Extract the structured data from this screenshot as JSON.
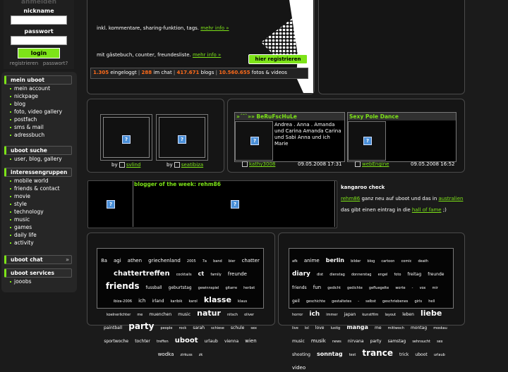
{
  "login": {
    "title": "anmelden",
    "nickname_label": "nickname",
    "password_label": "passwort",
    "button": "login",
    "register_link": "registrieren",
    "forgot_link": "passwort?"
  },
  "sidebar": {
    "sections": [
      {
        "title": "mein uboot",
        "items": [
          "mein account",
          "nickpage",
          "blog",
          "foto, video gallery",
          "postfach",
          "sms & mail",
          "adressbuch"
        ]
      },
      {
        "title": "uboot suche",
        "items": [
          "user, blog, gallery"
        ]
      },
      {
        "title": "interessengruppen",
        "items": [
          "mobile world",
          "friends & contact",
          "movie",
          "style",
          "technology",
          "music",
          "games",
          "daily life",
          "activity"
        ]
      },
      {
        "title": "uboot chat",
        "items": []
      },
      {
        "title": "uboot services",
        "items": [
          "jooobs"
        ]
      }
    ],
    "chat_arrow": "»"
  },
  "promo": {
    "line1": "inkl. kommentare, sharing-funktion, tags.",
    "line1_link": "mehr info »",
    "line2": "mit gästebuch, counter, freundesliste.",
    "line2_link": "mehr info »",
    "register_button": "hier registrieren"
  },
  "stats": {
    "logged_in_count": "1.305",
    "logged_in_label": "eingeloggt",
    "chat_count": "288",
    "chat_label": "im chat",
    "blogs_count": "417.671",
    "blogs_label": "blogs",
    "media_count": "10.560.655",
    "media_label": "fotos & videos",
    "sep": "|"
  },
  "users": {
    "by": "by",
    "user1": "svlind",
    "user2": "seatibiza"
  },
  "blogs": {
    "blog1_title": "»´¯`»» BeRuFscHuLe",
    "blog1_text": "Andrea . Anna . Amanda und Carina Amanda Carina und Sabi Anna und ich Marie",
    "blog1_user": "kathy3008",
    "blog1_date": "09.05.2008 17:31",
    "blog2_title": "Sexy Pole Dance",
    "blog2_user": "webEngine",
    "blog2_date": "09.05.2008 16:52"
  },
  "blogger_week": {
    "title": "blogger of the week: rehm86"
  },
  "kangaroo": {
    "title": "kangaroo check",
    "user": "rehm86",
    "text1": "ganz neu auf uboot und das in",
    "country": "australien",
    "text2": "das gibt einen eintrag in die",
    "hof": "hall of fame",
    "end": ";)"
  },
  "cloud_left": [
    [
      "8a",
      7
    ],
    [
      "agi",
      7
    ],
    [
      "athen",
      7
    ],
    [
      "griechenland",
      7
    ],
    [
      "2005",
      5
    ],
    [
      "7a",
      5
    ],
    [
      "band",
      5
    ],
    [
      "bier",
      5
    ],
    [
      "chatter",
      7
    ],
    [
      "chattertreffen",
      10
    ],
    [
      "cocktails",
      5
    ],
    [
      "ct",
      8
    ],
    [
      "family",
      5
    ],
    [
      "freunde",
      7
    ],
    [
      "friends",
      12
    ],
    [
      "fussball",
      6
    ],
    [
      "geburtstag",
      6
    ],
    [
      "gewinnspiel",
      5
    ],
    [
      "gitarre",
      5
    ],
    [
      "herbst",
      5
    ],
    [
      "ibiza-2006",
      5
    ],
    [
      "ich",
      7
    ],
    [
      "irland",
      6
    ],
    [
      "karibik",
      5
    ],
    [
      "karol",
      5
    ],
    [
      "klasse",
      11
    ],
    [
      "klaus",
      5
    ],
    [
      "koelnerlichter",
      5
    ],
    [
      "me",
      5
    ],
    [
      "muenchen",
      6
    ],
    [
      "music",
      6
    ],
    [
      "natur",
      11
    ],
    [
      "nitsch",
      5
    ],
    [
      "oliver",
      5
    ],
    [
      "paintball",
      6
    ],
    [
      "party",
      12
    ],
    [
      "people",
      5
    ],
    [
      "rock",
      5
    ],
    [
      "sarah",
      6
    ],
    [
      "schiese",
      5
    ],
    [
      "schule",
      6
    ],
    [
      "sex",
      5
    ],
    [
      "sportwoche",
      6
    ],
    [
      "tochter",
      6
    ],
    [
      "treffen",
      5
    ],
    [
      "uboot",
      10
    ],
    [
      "urlaub",
      6
    ],
    [
      "vienna",
      6
    ],
    [
      "wien",
      7
    ],
    [
      "wodka",
      7
    ],
    [
      "zirkuss",
      5
    ],
    [
      "zk",
      5
    ]
  ],
  "cloud_right": [
    [
      "afk",
      5
    ],
    [
      "anime",
      7
    ],
    [
      "berlin",
      8
    ],
    [
      "bilder",
      5
    ],
    [
      "blog",
      5
    ],
    [
      "cartoon",
      5
    ],
    [
      "comic",
      5
    ],
    [
      "death",
      5
    ],
    [
      "diary",
      9
    ],
    [
      "dist",
      5
    ],
    [
      "dienstag",
      5
    ],
    [
      "donnerstag",
      5
    ],
    [
      "engel",
      5
    ],
    [
      "foto",
      5
    ],
    [
      "freitag",
      6
    ],
    [
      "freunde",
      6
    ],
    [
      "friends",
      6
    ],
    [
      "fun",
      7
    ],
    [
      "gedicht",
      5
    ],
    [
      "gedichte",
      5
    ],
    [
      "gefluegelte",
      5
    ],
    [
      "worte",
      5
    ],
    [
      "-",
      5
    ],
    [
      "vox",
      5
    ],
    [
      "mir",
      5
    ],
    [
      "geil",
      6
    ],
    [
      "geschichte",
      5
    ],
    [
      "gestaltetes",
      5
    ],
    [
      "-",
      5
    ],
    [
      "selbst",
      5
    ],
    [
      "geschriebenes",
      5
    ],
    [
      "girls",
      5
    ],
    [
      "hell",
      5
    ],
    [
      "horror",
      5
    ],
    [
      "ich",
      9
    ],
    [
      "immer",
      5
    ],
    [
      "japan",
      6
    ],
    [
      "kunstfilm",
      5
    ],
    [
      "layout",
      5
    ],
    [
      "leben",
      6
    ],
    [
      "liebe",
      11
    ],
    [
      "live",
      5
    ],
    [
      "lol",
      5
    ],
    [
      "love",
      6
    ],
    [
      "lustig",
      5
    ],
    [
      "manga",
      8
    ],
    [
      "me",
      6
    ],
    [
      "mittwoch",
      5
    ],
    [
      "montag",
      6
    ],
    [
      "moskau",
      5
    ],
    [
      "music",
      6
    ],
    [
      "musik",
      7
    ],
    [
      "news",
      5
    ],
    [
      "nirvana",
      6
    ],
    [
      "party",
      6
    ],
    [
      "samstag",
      6
    ],
    [
      "sehnsucht",
      5
    ],
    [
      "sex",
      5
    ],
    [
      "shooting",
      6
    ],
    [
      "sonntag",
      8
    ],
    [
      "test",
      5
    ],
    [
      "trance",
      12
    ],
    [
      "trick",
      6
    ],
    [
      "uboot",
      6
    ],
    [
      "urlaub",
      5
    ],
    [
      "video",
      7
    ]
  ]
}
